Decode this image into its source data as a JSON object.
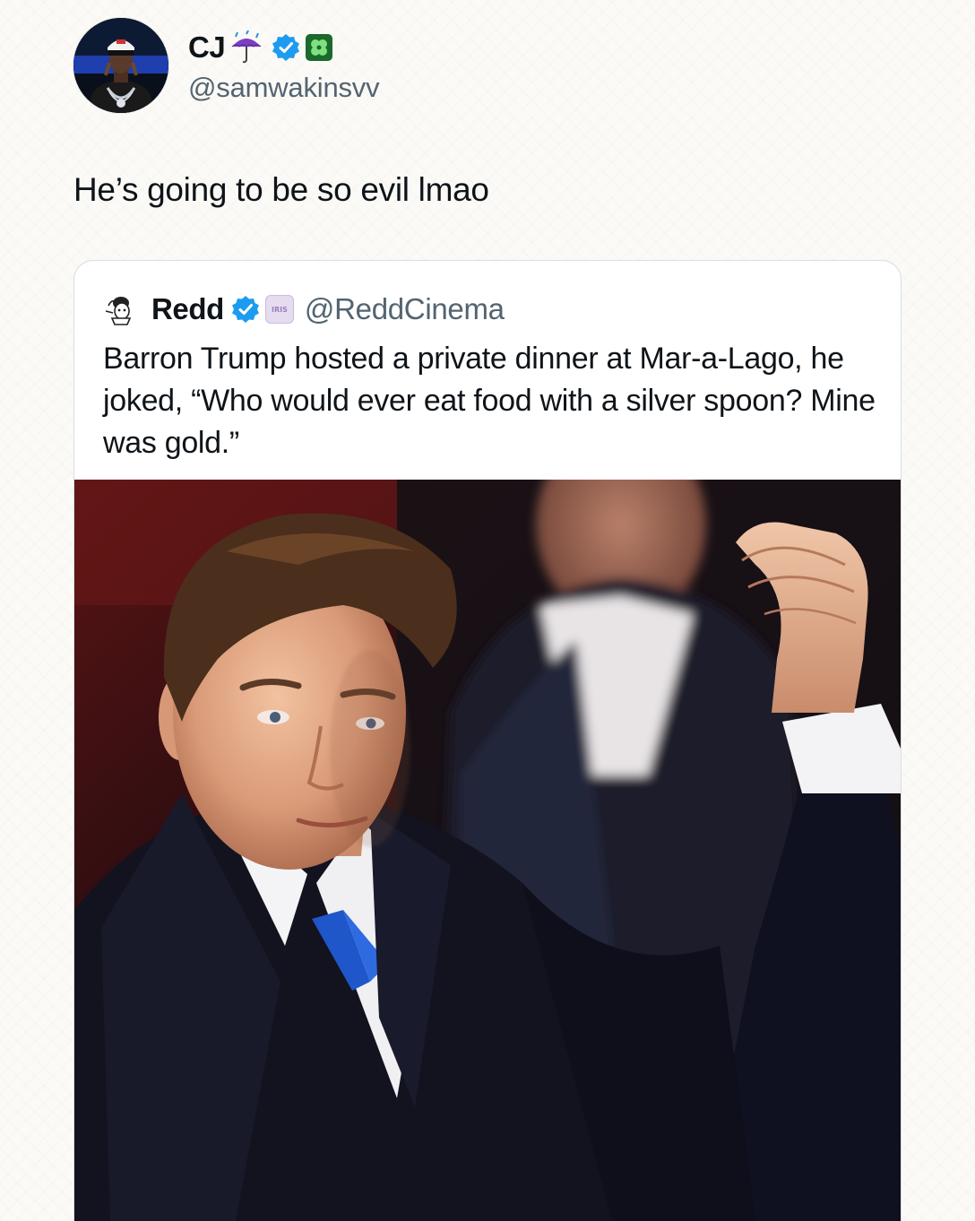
{
  "tweet": {
    "author": {
      "display_name": "CJ",
      "handle": "@samwakinsvv",
      "name_emojis": [
        "umbrella-with-rain-emoji",
        "four-leaf-clover-emoji"
      ],
      "verified": true
    },
    "text": "He’s going to be so evil lmao"
  },
  "quoted_tweet": {
    "author": {
      "display_name": "Redd",
      "handle": "@ReddCinema",
      "affiliate_badge": "IRIS",
      "verified": true
    },
    "text": "Barron Trump hosted a private dinner at Mar-a-Lago, he joked, “Who would ever eat food with a silver spoon? Mine was gold.”",
    "media": {
      "type": "photo",
      "subject": "young man in dark suit and blue tie raising a fist"
    }
  },
  "colors": {
    "background": "#fbfaf6",
    "text_primary": "#0f1419",
    "text_secondary": "#536471",
    "verified_blue": "#1d9bf0",
    "card_border": "#d9dee2"
  }
}
